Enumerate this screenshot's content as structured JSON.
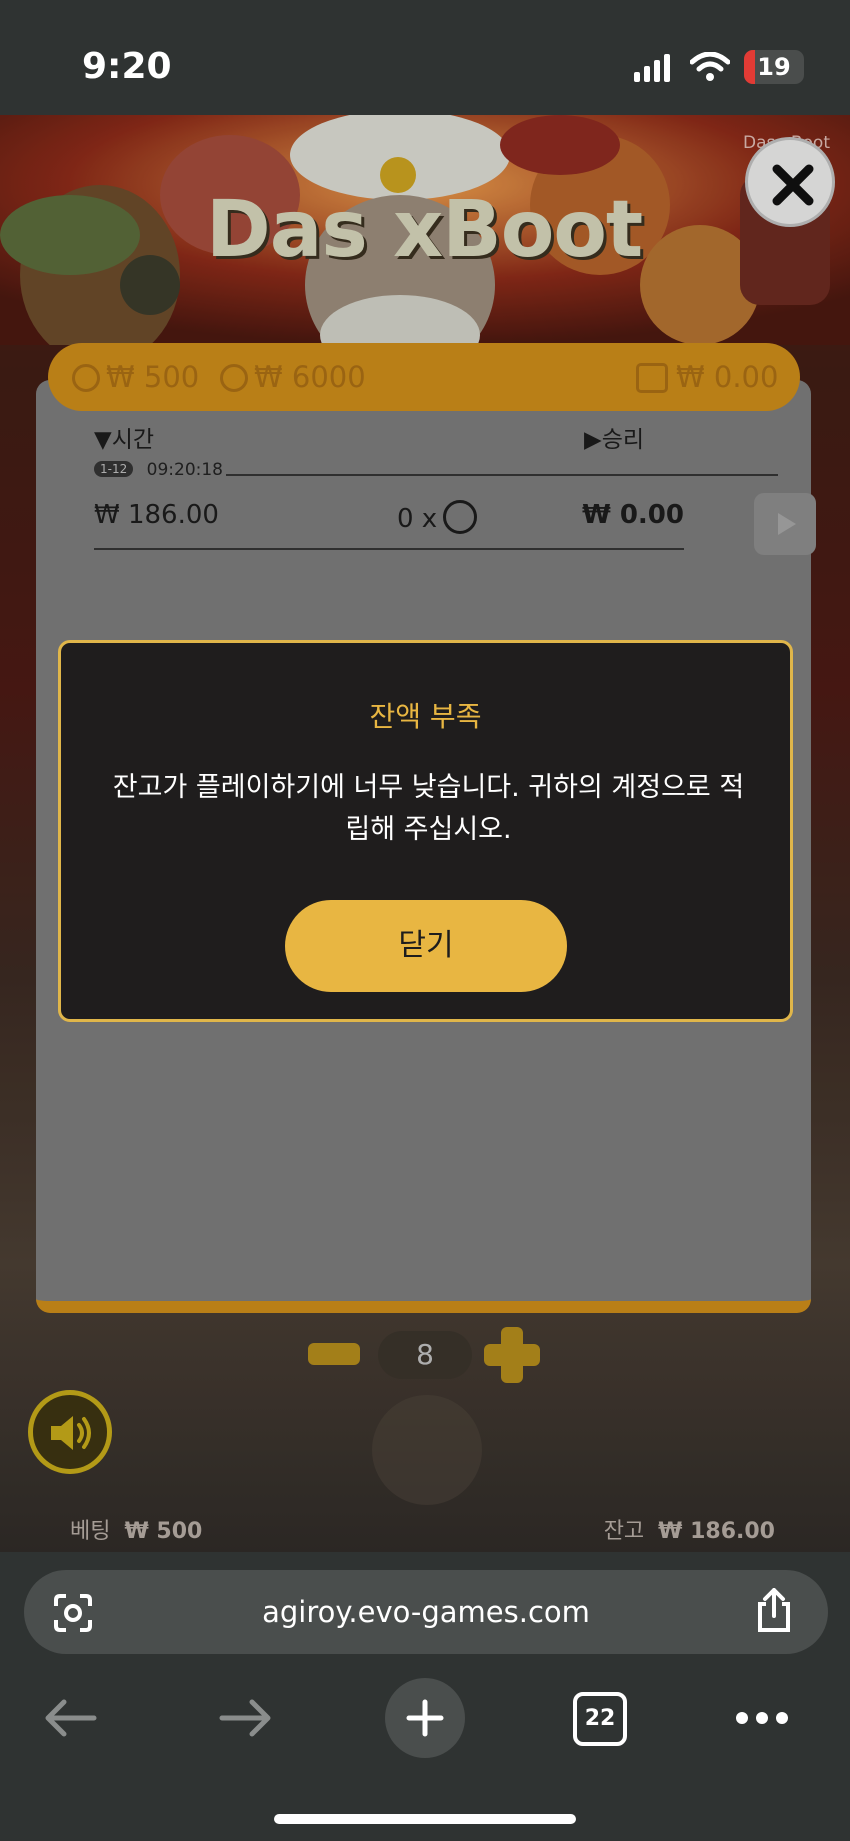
{
  "status_bar": {
    "time": "9:20",
    "battery": "19",
    "battery_level": 0.19
  },
  "game": {
    "title": "Das xBoot",
    "corner_label": "Das xBoot",
    "stakes": {
      "min": "₩ 500",
      "max": "₩ 6000",
      "wallet": "₩ 0.00"
    },
    "history": {
      "time_header": "▼시간",
      "win_header": "▶승리",
      "round_badge": "1-12",
      "timestamp": "09:20:18",
      "bet": "₩ 186.00",
      "multiplier": "0 x",
      "win": "₩ 0.00"
    },
    "stepper_value": "8",
    "bet_label": "베팅",
    "bet_value": "₩ 500",
    "balance_label": "잔고",
    "balance_value": "₩ 186.00"
  },
  "dialog": {
    "title": "잔액 부족",
    "message": "잔고가 플레이하기에 너무 낮습니다. 귀하의 계정으로 적립해 주십시오.",
    "close_button": "닫기"
  },
  "browser": {
    "url": "agiroy.evo-games.com",
    "tab_count": "22"
  },
  "icons": [
    "close-icon",
    "coin-icon",
    "wallet-icon",
    "play-icon",
    "minus-icon",
    "plus-icon",
    "speaker-icon",
    "camera-search-icon",
    "share-icon",
    "back-arrow-icon",
    "forward-arrow-icon",
    "plus-icon",
    "more-icon"
  ],
  "colors": {
    "accent": "#e8b642",
    "stake_bar": "#c98a1a",
    "dialog_bg": "#1f1d1d"
  }
}
